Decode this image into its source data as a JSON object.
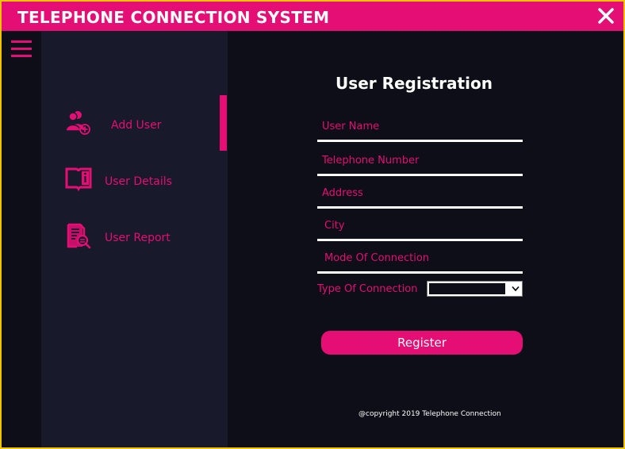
{
  "app": {
    "title": "TELEPHONE CONNECTION SYSTEM",
    "accent_color": "#e40e74",
    "background_color": "#0d0e17",
    "sidebar_color": "#181a2b",
    "close_icon": "close-icon",
    "menu_icon": "hamburger-menu-icon"
  },
  "sidebar": {
    "items": [
      {
        "label": "Add User",
        "icon": "add-user-icon",
        "active": true
      },
      {
        "label": "User Details",
        "icon": "user-details-book-icon",
        "active": false
      },
      {
        "label": "User Report",
        "icon": "user-report-icon",
        "active": false
      }
    ]
  },
  "form": {
    "title": "User Registration",
    "fields": [
      {
        "placeholder": "User Name",
        "value": ""
      },
      {
        "placeholder": "Telephone Number",
        "value": ""
      },
      {
        "placeholder": "Address",
        "value": ""
      },
      {
        "placeholder": "City",
        "value": ""
      },
      {
        "placeholder": "Mode Of Connection",
        "value": ""
      }
    ],
    "type_label": "Type Of Connection",
    "type_value": "",
    "register_label": "Register"
  },
  "footer": {
    "copyright": "@copyright 2019 Telephone Connection"
  }
}
